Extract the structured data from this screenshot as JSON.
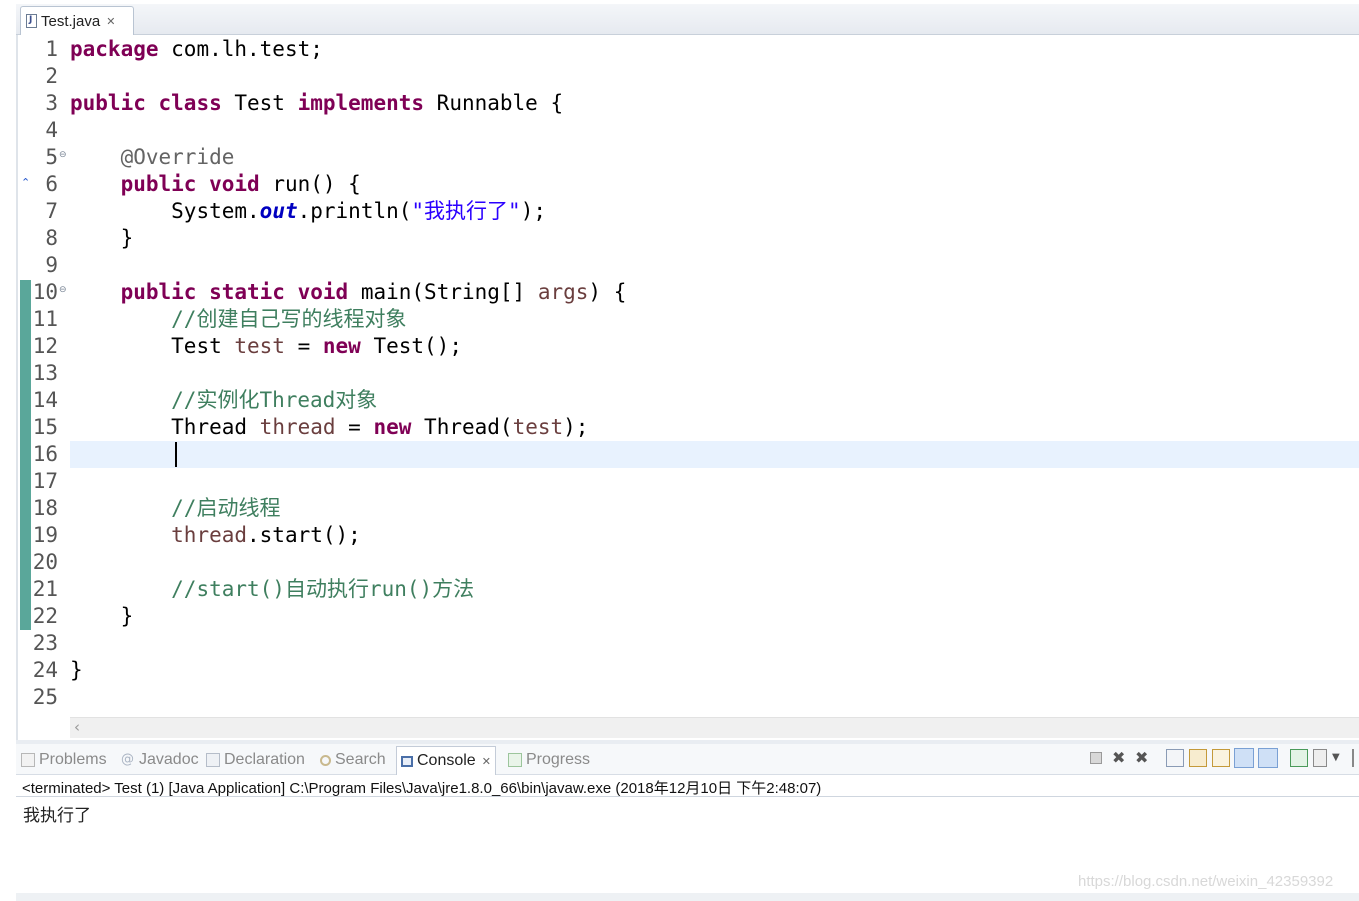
{
  "editor": {
    "tab": {
      "label": "Test.java",
      "close_symbol": "✕",
      "icon": "java-file-icon"
    },
    "line_numbers": [
      "1",
      "2",
      "3",
      "4",
      "5",
      "6",
      "7",
      "8",
      "9",
      "10",
      "11",
      "12",
      "13",
      "14",
      "15",
      "16",
      "17",
      "18",
      "19",
      "20",
      "21",
      "22",
      "23",
      "24",
      "25"
    ],
    "fold_icon_symbol": "⊖",
    "override_marker": "⌃",
    "code": {
      "l1": {
        "kw": "package",
        "rest": " com.lh.test;"
      },
      "l3": {
        "kw1": "public",
        "kw2": "class",
        "mid": " Test ",
        "kw3": "implements",
        "rest": " Runnable {"
      },
      "l5": {
        "ann": "@Override"
      },
      "l6": {
        "kw1": "public",
        "kw2": "void",
        "rest": " run() {"
      },
      "l7": {
        "pre": "System.",
        "field": "out",
        "mid": ".println(",
        "str": "\"我执行了\"",
        "rest": ");"
      },
      "l8": {
        "text": "}"
      },
      "l10": {
        "kw1": "public",
        "kw2": "static",
        "kw3": "void",
        "mid": " main(String[] ",
        "var": "args",
        "rest": ") {"
      },
      "l11": {
        "cmt": "//创建自己写的线程对象"
      },
      "l12": {
        "pre": "Test ",
        "var": "test",
        "mid": " = ",
        "kw": "new",
        "rest": " Test();"
      },
      "l14": {
        "cmt": "//实例化Thread对象"
      },
      "l15": {
        "pre": "Thread ",
        "var": "thread",
        "mid": " = ",
        "kw": "new",
        "post": " Thread(",
        "var2": "test",
        "rest": ");"
      },
      "l18": {
        "cmt": "//启动线程"
      },
      "l19": {
        "var": "thread",
        "rest": ".start();"
      },
      "l21": {
        "cmt": "//start()自动执行run()方法"
      },
      "l22": {
        "text": "}"
      },
      "l24": {
        "text": "}"
      }
    },
    "scroll_left_arrow": "‹"
  },
  "views": {
    "tabs": {
      "problems": "Problems",
      "javadoc": "Javadoc",
      "declaration": "Declaration",
      "search": "Search",
      "console": "Console",
      "progress": "Progress"
    },
    "console_close_symbol": "✕",
    "javadoc_icon_glyph": "@"
  },
  "console": {
    "status": "<terminated> Test (1) [Java Application] C:\\Program Files\\Java\\jre1.8.0_66\\bin\\javaw.exe (2018年12月10日 下午2:48:07)",
    "output": "我执行了"
  },
  "watermark": "https://blog.csdn.net/weixin_42359392"
}
